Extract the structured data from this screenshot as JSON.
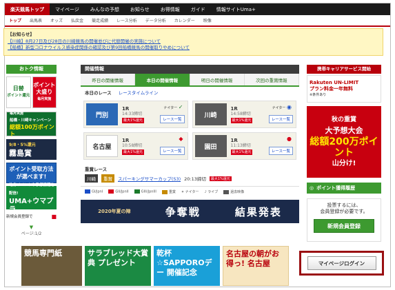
{
  "global_nav": [
    "楽天競馬トップ",
    "マイページ",
    "みんなの予想",
    "お知らせ",
    "お得情報",
    "ガイド",
    "情報サイトUma+"
  ],
  "sub_nav": [
    "トップ",
    "出馬表",
    "オッズ",
    "払戻金",
    "競走成績",
    "レース分析",
    "データ分析",
    "カレンダー",
    "映像"
  ],
  "notice": {
    "title": "【お知らせ】",
    "lines": [
      "【川崎】8月27日及び28日の川崎競馬の開催並びに代替開催の実施について",
      "【船橋】新型コロナウイルス感染症関係の確認及び第9回船橋競馬の開催取りやめについて"
    ]
  },
  "left": {
    "header": "おトク情報",
    "banner1": [
      "日替",
      "ポイント還元"
    ],
    "banner2": [
      "ポイント",
      "大盛り",
      "毎月実施"
    ],
    "banner3": [
      "毎月実施",
      "船橋・川崎キャンペーン",
      "総額100万ポイント"
    ],
    "banner4": [
      "9/8・5%還元",
      "霧島賞"
    ],
    "banner5": [
      "ポイント受取方法",
      "が選べます!"
    ],
    "banner6": [
      "地方イベントや予想情報を配信!",
      "UMA+ウマプラ"
    ],
    "banner7": "新規会員登録で",
    "pager": "ページ:1/2"
  },
  "center": {
    "header": "開催情報",
    "tabs": [
      "昨日の開催情報",
      "本日の開催情報",
      "明日の開催情報",
      "次回の重賞情報"
    ],
    "subtabs": [
      "本日のレース",
      "レースタイムライン"
    ],
    "cards": [
      {
        "venue": "門別",
        "race": "1R",
        "time": "14:33締切",
        "badge": "最大1%還元",
        "btn": "レース一覧",
        "tag": "ナイター"
      },
      {
        "venue": "川崎",
        "race": "1R",
        "time": "14:58締切",
        "badge": "最大1%還元",
        "btn": "レース一覧",
        "tag": "ナイター"
      },
      {
        "venue": "名古屋",
        "race": "1R",
        "time": "10:58締切",
        "badge": "最大1%還元",
        "btn": "レース一覧",
        "tag": ""
      },
      {
        "venue": "園田",
        "race": "1R",
        "time": "11:13締切",
        "badge": "最大1%還元",
        "btn": "レース一覧",
        "tag": ""
      }
    ],
    "juusho": {
      "title": "重賞レース",
      "venue": "川崎",
      "grade": "重賞",
      "name": "スパーキングサマーカップ(S3)",
      "time": "20:13締切",
      "badge": "最大1%還元"
    },
    "legend": [
      "GI/JpnI",
      "GII/JpnII",
      "GIII/JpnIII",
      "重賞",
      "ナイター",
      "ライブ",
      "過去映像"
    ],
    "result_banner": {
      "small": "2020年夏の陣",
      "title": "争奪戦",
      "result": "結果発表"
    }
  },
  "right": {
    "header": "携帯キャリアサービス開始",
    "rakuten": [
      "Rakuten UN-LIMIT",
      "プラン料金一年無料",
      "※条件あり"
    ],
    "yoso": [
      "秋の重賞",
      "大予想大会",
      "総額200万ポイント",
      "山分け!"
    ],
    "point_history": "ポイント獲得履歴",
    "register_text": [
      "投票するには、",
      "会員登録が必要です。"
    ],
    "register_btn": "新規会員登録",
    "mypage_btn": "マイページログイン"
  },
  "bottom": [
    "競馬専門紙",
    "サラブレッド大賞典 プレゼント",
    "乾杯☆SAPPOROデー 開催記念",
    "名古屋の朝がお得っ! 名古屋"
  ],
  "colors": {
    "brand_red": "#b8000b",
    "green": "#3d9a30",
    "link": "#1a4ec8"
  }
}
